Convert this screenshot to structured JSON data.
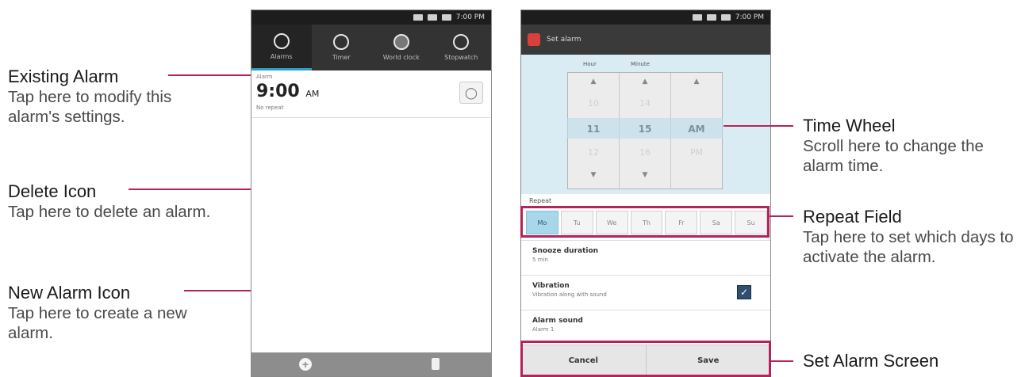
{
  "callouts": {
    "existing_alarm": {
      "title": "Existing Alarm",
      "desc": "Tap here to modify this alarm's settings."
    },
    "delete_icon": {
      "title": "Delete Icon",
      "desc": "Tap here to delete an alarm."
    },
    "new_alarm_icon": {
      "title": "New Alarm Icon",
      "desc": "Tap here to create a new alarm."
    },
    "time_wheel": {
      "title": "Time Wheel",
      "desc": "Scroll here to change the alarm time."
    },
    "repeat_field": {
      "title": "Repeat Field",
      "desc": "Tap here to set which days to activate the alarm."
    },
    "set_alarm_screen": {
      "title": "Set Alarm Screen"
    }
  },
  "phone1": {
    "status_time": "7:00 PM",
    "tabs": [
      {
        "label": "Alarms",
        "icon": "alarm-clock-icon"
      },
      {
        "label": "Timer",
        "icon": "timer-icon"
      },
      {
        "label": "World clock",
        "icon": "globe-icon"
      },
      {
        "label": "Stopwatch",
        "icon": "stopwatch-icon"
      }
    ],
    "alarm": {
      "label": "Alarm",
      "time": "9:00",
      "ampm": "AM",
      "repeat": "No repeat"
    }
  },
  "phone2": {
    "status_time": "7:00 PM",
    "title": "Set alarm",
    "hour_label": "Hour",
    "minute_label": "Minute",
    "hours": [
      "10",
      "11",
      "12"
    ],
    "minutes": [
      "14",
      "15",
      "16"
    ],
    "ampm": [
      "",
      "AM",
      "PM"
    ],
    "repeat_label": "Repeat",
    "days": [
      "Mo",
      "Tu",
      "We",
      "Th",
      "Fr",
      "Sa",
      "Su"
    ],
    "snooze": {
      "title": "Snooze duration",
      "value": "5 min"
    },
    "vibration": {
      "title": "Vibration",
      "value": "Vibration along with sound"
    },
    "alarm_sound": {
      "title": "Alarm sound",
      "value": "Alarm 1"
    },
    "cancel_label": "Cancel",
    "save_label": "Save"
  },
  "colors": {
    "accent": "#b3245a",
    "highlight": "#2aa0c8"
  }
}
